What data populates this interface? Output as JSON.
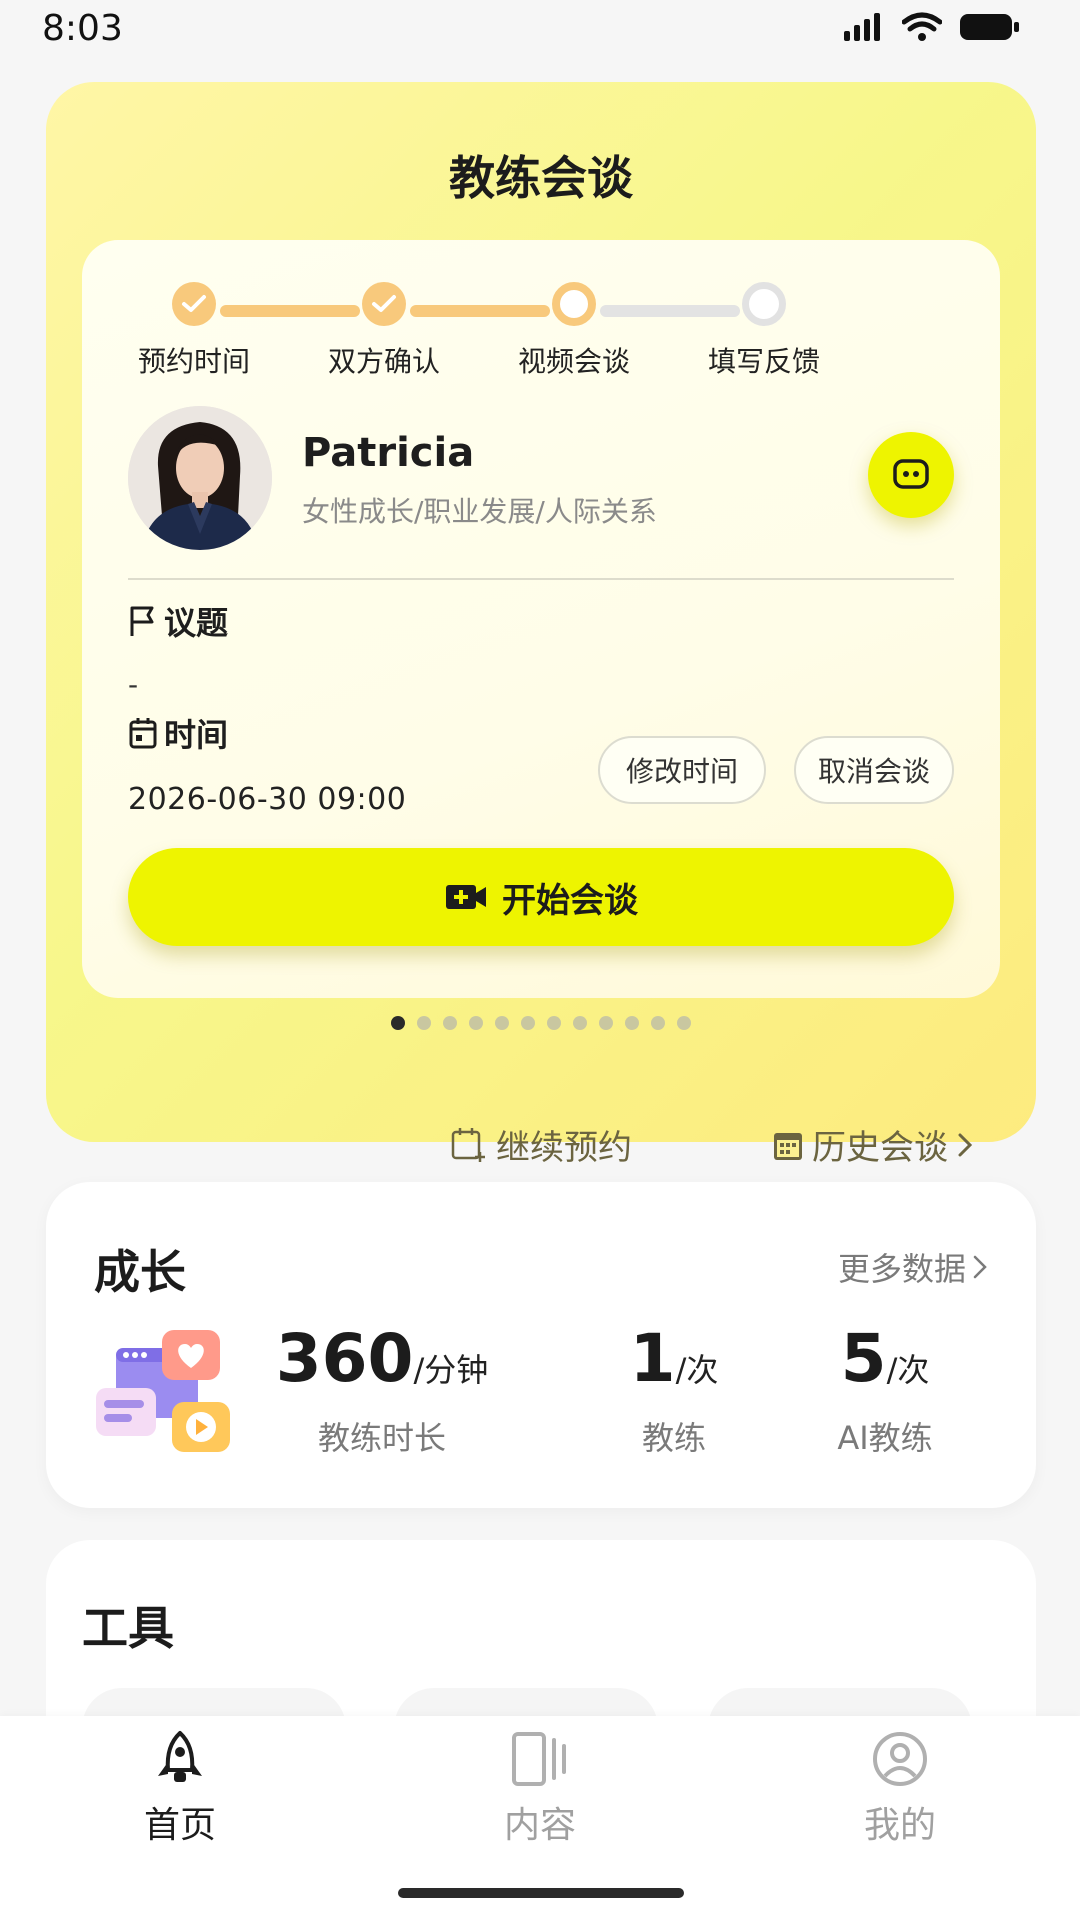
{
  "status_bar": {
    "time": "8:03"
  },
  "hero": {
    "title": "教练会谈",
    "steps": [
      {
        "label": "预约时间",
        "state": "done"
      },
      {
        "label": "双方确认",
        "state": "done"
      },
      {
        "label": "视频会谈",
        "state": "current"
      },
      {
        "label": "填写反馈",
        "state": "todo"
      }
    ],
    "coach": {
      "name": "Patricia",
      "tags": "女性成长/职业发展/人际关系"
    },
    "topic": {
      "label": "议题",
      "value": "-"
    },
    "time": {
      "label": "时间",
      "value": "2026-06-30 09:00",
      "modify_button": "修改时间",
      "cancel_button": "取消会谈"
    },
    "start_button": "开始会谈",
    "pager": {
      "total": 12,
      "active": 1
    },
    "continue_booking": "继续预约",
    "history": "历史会谈"
  },
  "growth": {
    "title": "成长",
    "more_link": "更多数据",
    "stats": [
      {
        "value": "360",
        "unit": "/分钟",
        "label": "教练时长"
      },
      {
        "value": "1",
        "unit": "/次",
        "label": "教练"
      },
      {
        "value": "5",
        "unit": "/次",
        "label": "AI教练"
      }
    ]
  },
  "tools": {
    "title": "工具"
  },
  "nav": {
    "items": [
      {
        "label": "首页",
        "active": true
      },
      {
        "label": "内容",
        "active": false
      },
      {
        "label": "我的",
        "active": false
      }
    ]
  },
  "colors": {
    "accent": "#eef400",
    "step_done": "#f8c97c",
    "hero_bg": "#f7f78b"
  }
}
